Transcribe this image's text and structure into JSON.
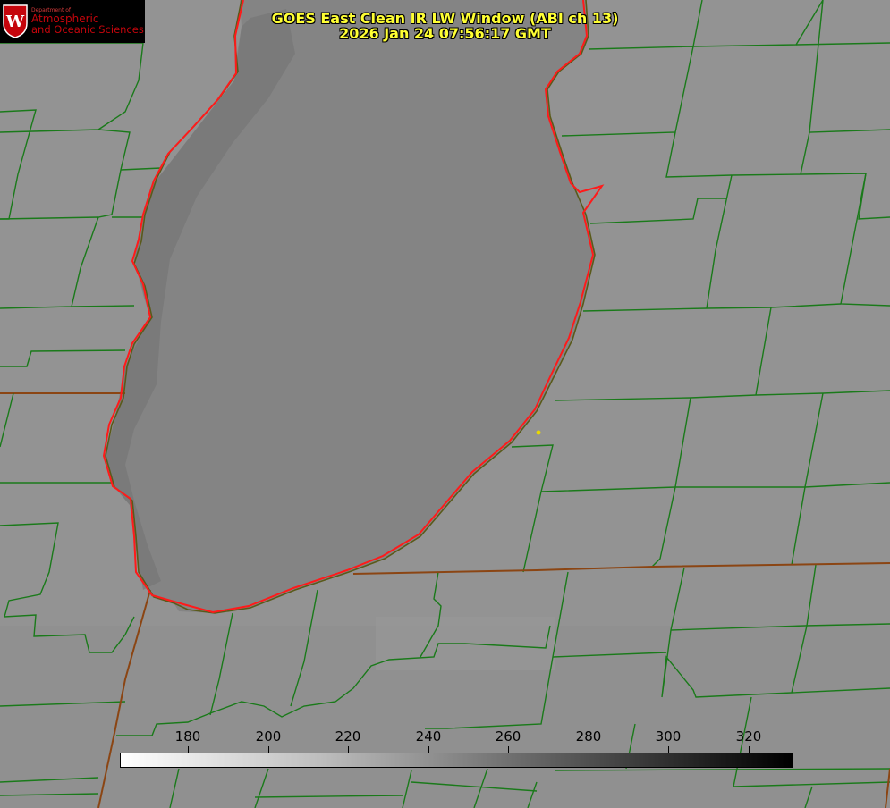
{
  "title": {
    "line1": "GOES East Clean IR LW Window (ABI ch 13)",
    "line2": "2026 Jan 24 07:56:17 GMT"
  },
  "logo": {
    "dept": "Department of",
    "line1": "Atmospheric",
    "line2": "and Oceanic Sciences",
    "icon": "uw-crest-icon"
  },
  "colorbar": {
    "ticks": [
      "180",
      "200",
      "220",
      "240",
      "260",
      "280",
      "300",
      "320"
    ],
    "tick_values": [
      180,
      200,
      220,
      240,
      260,
      280,
      300,
      320
    ],
    "range": [
      163,
      331
    ],
    "gradient": "white-to-black"
  },
  "colors": {
    "county_lines": "#1a7a1a",
    "state_lines": "#8b4513",
    "coastline": "#ff1a1a",
    "title_text": "#ffff33",
    "logo_text": "#c5050c",
    "background": "#8f8f8f",
    "lake": "#7a7a7a",
    "marker": "#e8d800"
  }
}
